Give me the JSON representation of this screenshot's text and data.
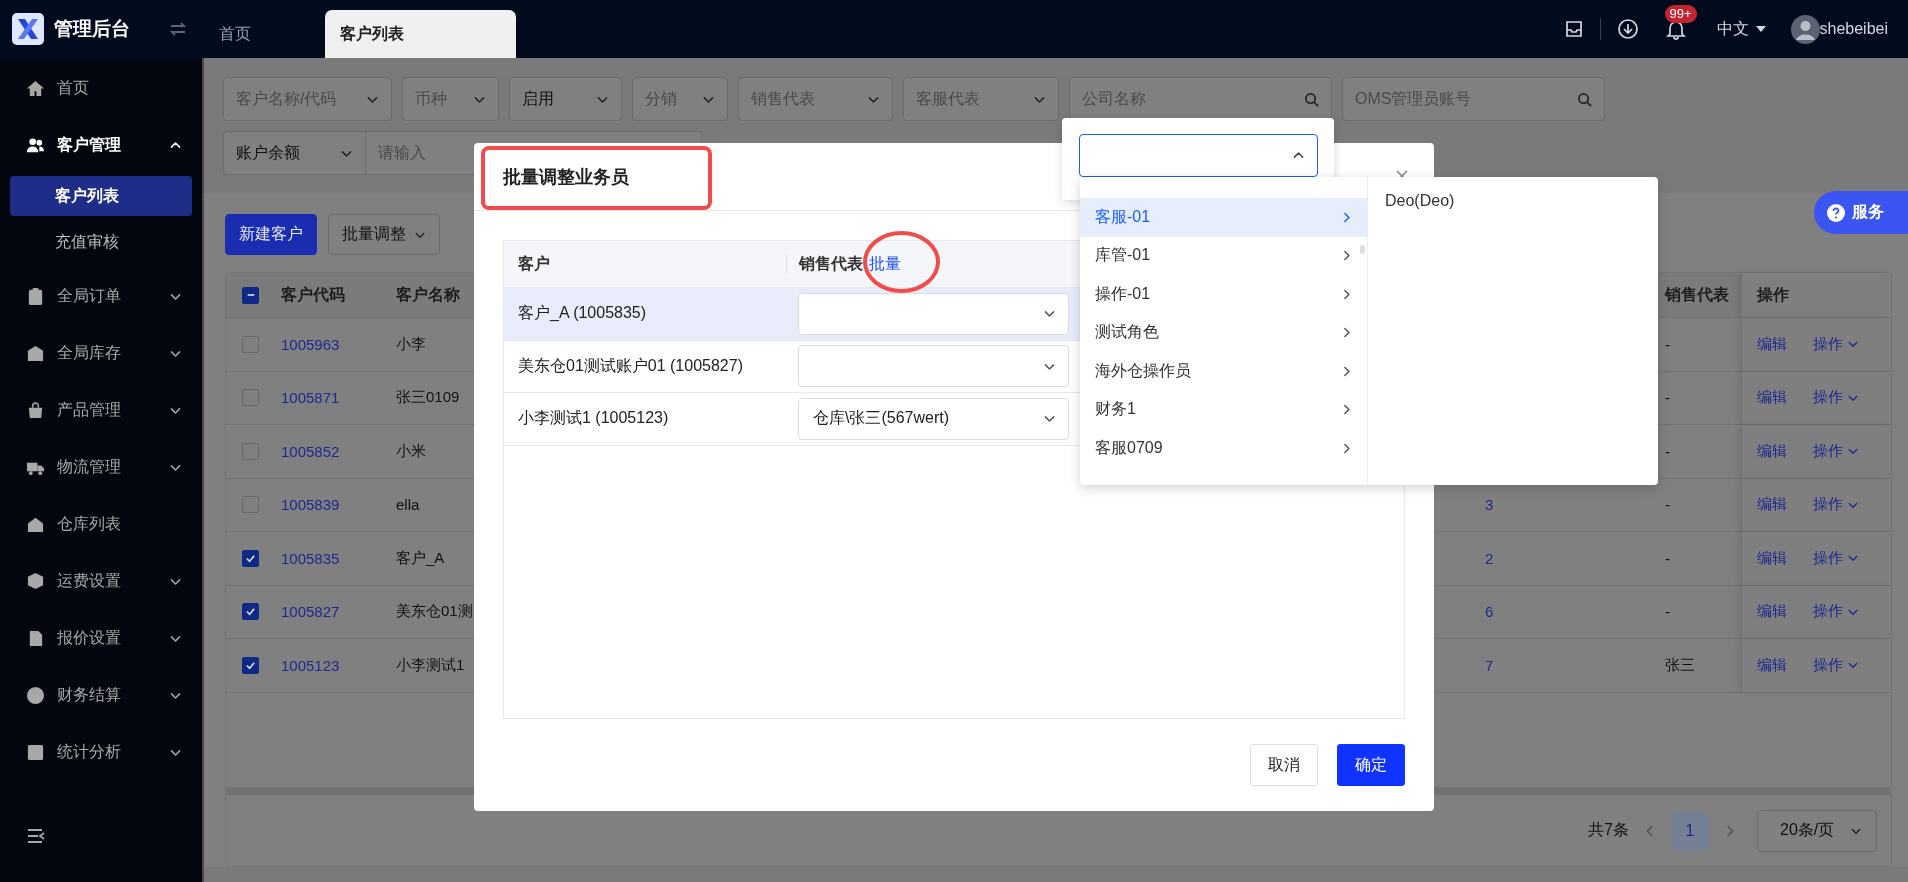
{
  "app": {
    "title": "管理后台"
  },
  "tabs": [
    {
      "label": "首页",
      "selected": false
    },
    {
      "label": "客户列表",
      "selected": true
    }
  ],
  "header": {
    "notification_count": "99+",
    "language": "中文",
    "user": "shebeibei"
  },
  "sidebar": {
    "items": [
      {
        "label": "首页",
        "kind": "link",
        "selected": false
      },
      {
        "label": "客户管理",
        "kind": "group",
        "expanded": true,
        "children": [
          {
            "label": "客户列表",
            "selected": true
          },
          {
            "label": "充值审核",
            "selected": false
          }
        ]
      },
      {
        "label": "全局订单",
        "kind": "group",
        "expanded": false
      },
      {
        "label": "全局库存",
        "kind": "group",
        "expanded": false
      },
      {
        "label": "产品管理",
        "kind": "group",
        "expanded": false
      },
      {
        "label": "物流管理",
        "kind": "group",
        "expanded": false
      },
      {
        "label": "仓库列表",
        "kind": "link",
        "selected": false
      },
      {
        "label": "运费设置",
        "kind": "group",
        "expanded": false
      },
      {
        "label": "报价设置",
        "kind": "group",
        "expanded": false
      },
      {
        "label": "财务结算",
        "kind": "group",
        "expanded": false
      },
      {
        "label": "统计分析",
        "kind": "group",
        "expanded": false
      }
    ]
  },
  "filters": {
    "rows": [
      [
        {
          "kind": "select",
          "placeholder": "客户名称/代码"
        },
        {
          "kind": "select",
          "placeholder": "币种"
        },
        {
          "kind": "select",
          "value": "启用"
        },
        {
          "kind": "select",
          "placeholder": "分销"
        },
        {
          "kind": "select",
          "placeholder": "销售代表"
        },
        {
          "kind": "select",
          "placeholder": "客服代表"
        },
        {
          "kind": "search",
          "placeholder": "公司名称"
        },
        {
          "kind": "search",
          "placeholder": "OMS管理员账号"
        }
      ],
      [
        {
          "kind": "select",
          "value": "账户余额"
        },
        {
          "kind": "input",
          "placeholder": "请输入"
        }
      ]
    ]
  },
  "toolbar": {
    "buttons": [
      {
        "label": "新建客户",
        "kind": "primary"
      },
      {
        "label": "批量调整",
        "kind": "dropdown"
      }
    ]
  },
  "table": {
    "select_all": {
      "indeterminate": true
    },
    "columns": {
      "code": "客户代码",
      "name": "客户名称",
      "sales_rep": "销售代表",
      "actions": "操作"
    },
    "rows": [
      {
        "checked": false,
        "code": "1005963",
        "name": "小李",
        "sales_rep": "-",
        "actions": [
          "编辑",
          "操作"
        ]
      },
      {
        "checked": false,
        "code": "1005871",
        "name": "张三0109",
        "sales_rep": "-",
        "actions": [
          "编辑",
          "操作"
        ]
      },
      {
        "checked": false,
        "code": "1005852",
        "name": "小米",
        "sales_rep": "-",
        "actions": [
          "编辑",
          "操作"
        ]
      },
      {
        "checked": false,
        "code": "1005839",
        "name": "ella",
        "column_3": "3",
        "sales_rep": "-",
        "actions": [
          "编辑",
          "操作"
        ]
      },
      {
        "checked": true,
        "code": "1005835",
        "name": "客户_A",
        "column_3": "2",
        "sales_rep": "-",
        "actions": [
          "编辑",
          "操作"
        ]
      },
      {
        "checked": true,
        "code": "1005827",
        "name": "美东仓01测",
        "column_3": "6",
        "sales_rep": "-",
        "actions": [
          "编辑",
          "操作"
        ]
      },
      {
        "checked": true,
        "code": "1005123",
        "name": "小李测试1",
        "column_3": "7",
        "sales_rep": "张三",
        "actions": [
          "编辑",
          "操作"
        ]
      }
    ]
  },
  "pagination": {
    "total": "共7条",
    "pages": [
      {
        "label": "1",
        "selected": true
      }
    ],
    "page_size": "20条/页"
  },
  "modal": {
    "title": "批量调整业务员",
    "title_highlighted": true,
    "columns": {
      "customer": "客户",
      "sales_rep": "销售代表"
    },
    "batch_link": "批量",
    "batch_link_circled": true,
    "rows": [
      {
        "customer": "客户_A (1005835)",
        "selected": true
      },
      {
        "customer": "美东仓01测试账户01 (1005827)",
        "selected": false
      },
      {
        "customer": "小李测试1 (1005123)",
        "sales_rep": "仓库\\张三(567wert)",
        "selected": false
      }
    ],
    "buttons": [
      {
        "label": "取消",
        "kind": "default"
      },
      {
        "label": "确定",
        "kind": "primary"
      }
    ]
  },
  "sales_rep_picker": {
    "open": true,
    "options": [
      {
        "label": "客服-01",
        "selected": true
      },
      {
        "label": "库管-01",
        "selected": false
      },
      {
        "label": "操作-01",
        "selected": false
      },
      {
        "label": "测试角色",
        "selected": false
      },
      {
        "label": "海外仓操作员",
        "selected": false
      },
      {
        "label": "财务1",
        "selected": false
      },
      {
        "label": "客服0709",
        "selected": false
      }
    ],
    "suboptions": [
      {
        "label": "Deo(Deo)"
      }
    ]
  },
  "service_button": {
    "label": "服务"
  }
}
